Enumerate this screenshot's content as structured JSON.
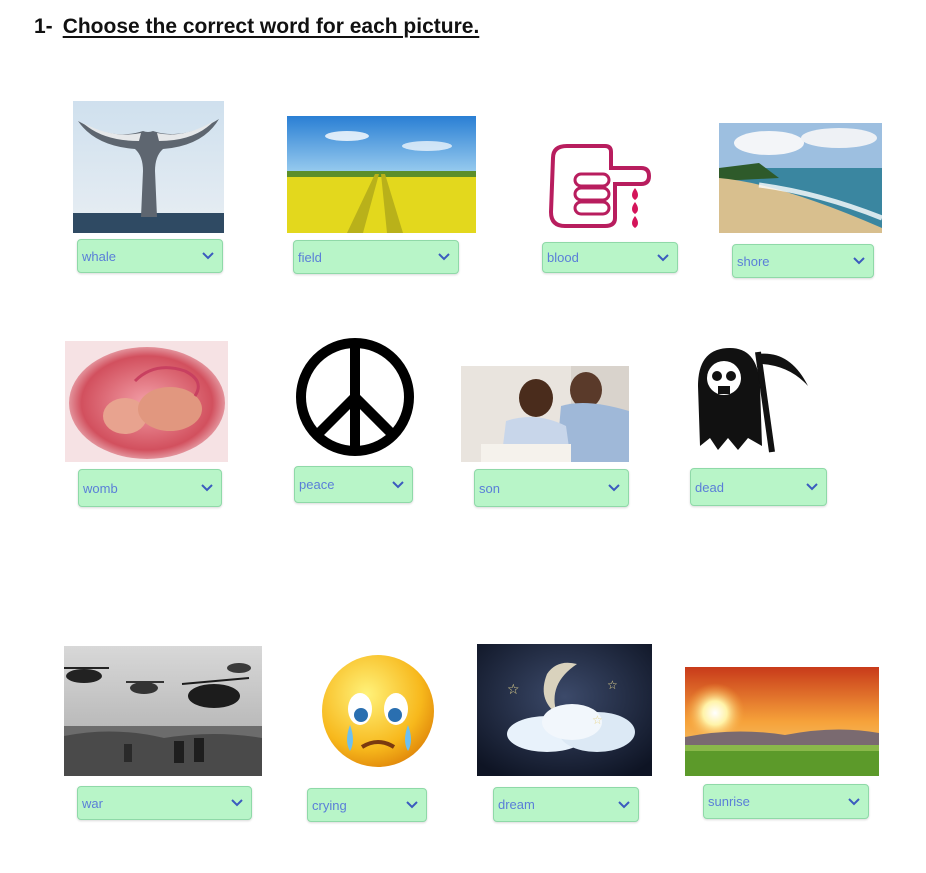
{
  "exercise": {
    "number": "1-",
    "instruction": "Choose the correct word for each picture."
  },
  "items": [
    {
      "answer": "whale",
      "icon": "whale-tail-icon"
    },
    {
      "answer": "field",
      "icon": "field-icon"
    },
    {
      "answer": "blood",
      "icon": "blood-icon"
    },
    {
      "answer": "shore",
      "icon": "shore-icon"
    },
    {
      "answer": "womb",
      "icon": "womb-icon"
    },
    {
      "answer": "peace",
      "icon": "peace-icon"
    },
    {
      "answer": "son",
      "icon": "son-icon"
    },
    {
      "answer": "dead",
      "icon": "grim-reaper-icon"
    },
    {
      "answer": "war",
      "icon": "war-icon"
    },
    {
      "answer": "crying",
      "icon": "crying-emoji-icon"
    },
    {
      "answer": "dream",
      "icon": "dream-icon"
    },
    {
      "answer": "sunrise",
      "icon": "sunrise-icon"
    }
  ],
  "colors": {
    "select_bg": "#b8f5c8",
    "select_text": "#5a7ed8"
  }
}
